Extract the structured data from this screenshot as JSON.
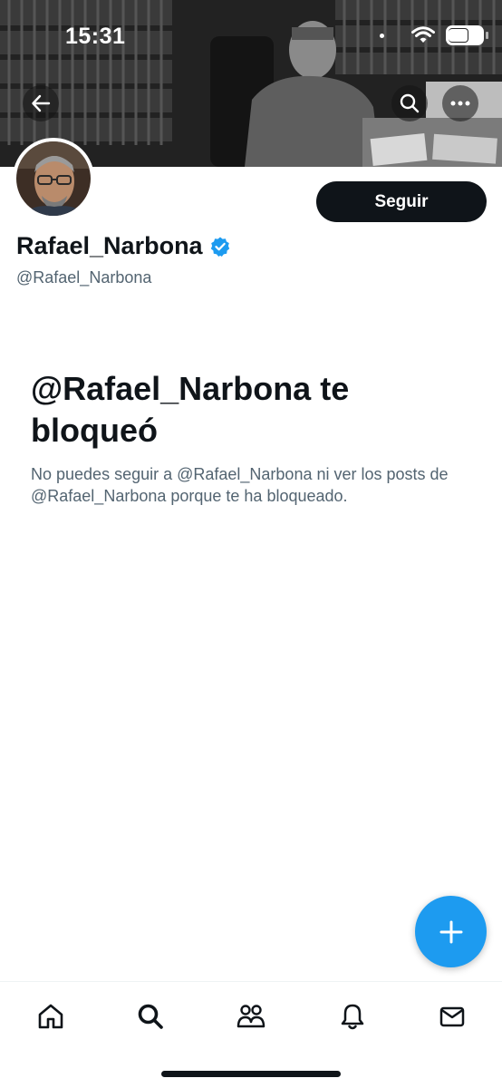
{
  "status_bar": {
    "time": "15:31"
  },
  "profile": {
    "display_name": "Rafael_Narbona",
    "handle": "@Rafael_Narbona",
    "follow_label": "Seguir",
    "verified": true
  },
  "blocked": {
    "title": "@Rafael_Narbona te bloqueó",
    "message": "No puedes seguir a @Rafael_Narbona ni ver los posts de @Rafael_Narbona porque te ha bloqueado."
  },
  "colors": {
    "accent": "#1d9bf0",
    "text_primary": "#0f1419",
    "text_secondary": "#536471"
  },
  "icons": {
    "back": "arrow-left-icon",
    "search": "search-icon",
    "more": "more-icon",
    "fab": "plus-icon",
    "nav": [
      "home-icon",
      "search-icon",
      "communities-icon",
      "bell-icon",
      "mail-icon"
    ]
  }
}
